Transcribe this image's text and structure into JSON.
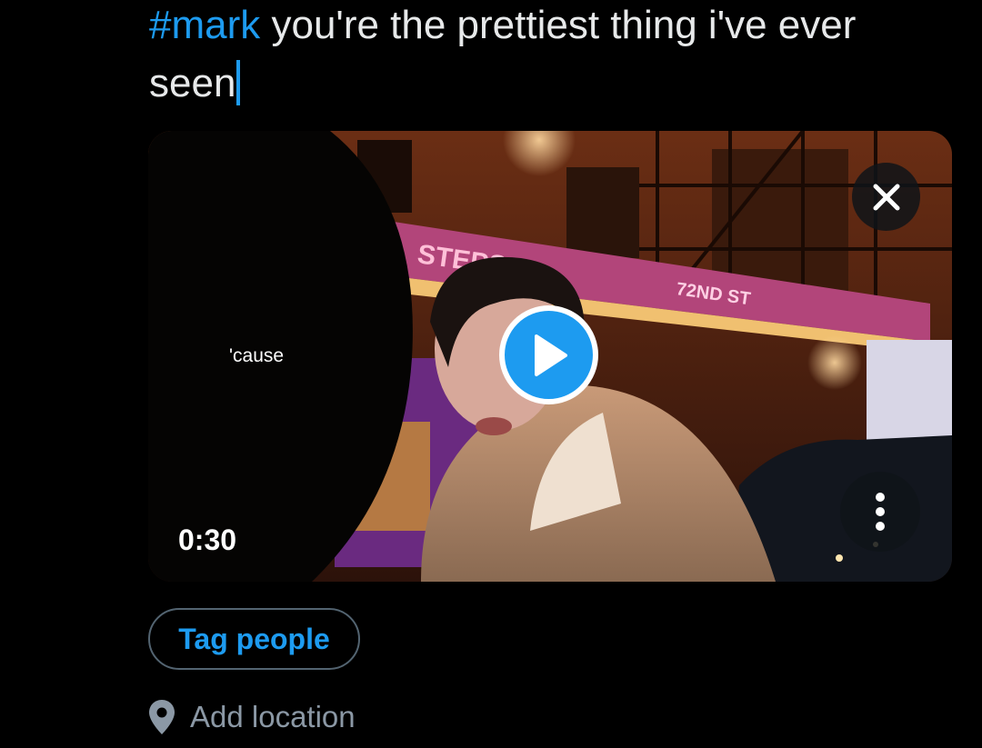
{
  "composer": {
    "hashtag": "#mark",
    "text": " you're the prettiest thing i've ever seen"
  },
  "media": {
    "subtitle": "'cause",
    "duration": "0:30",
    "sign_text": "STEPS",
    "sign_text2": "72ND ST",
    "close_icon": "close-icon",
    "play_icon": "play-icon",
    "more_icon": "more-vertical-icon"
  },
  "actions": {
    "tag_people": "Tag people",
    "add_location": "Add location",
    "location_icon": "map-pin-icon"
  },
  "colors": {
    "accent": "#1d9bf0",
    "background": "#000000",
    "text": "#e7e9ea",
    "muted": "#8b98a5",
    "border": "#536471"
  }
}
